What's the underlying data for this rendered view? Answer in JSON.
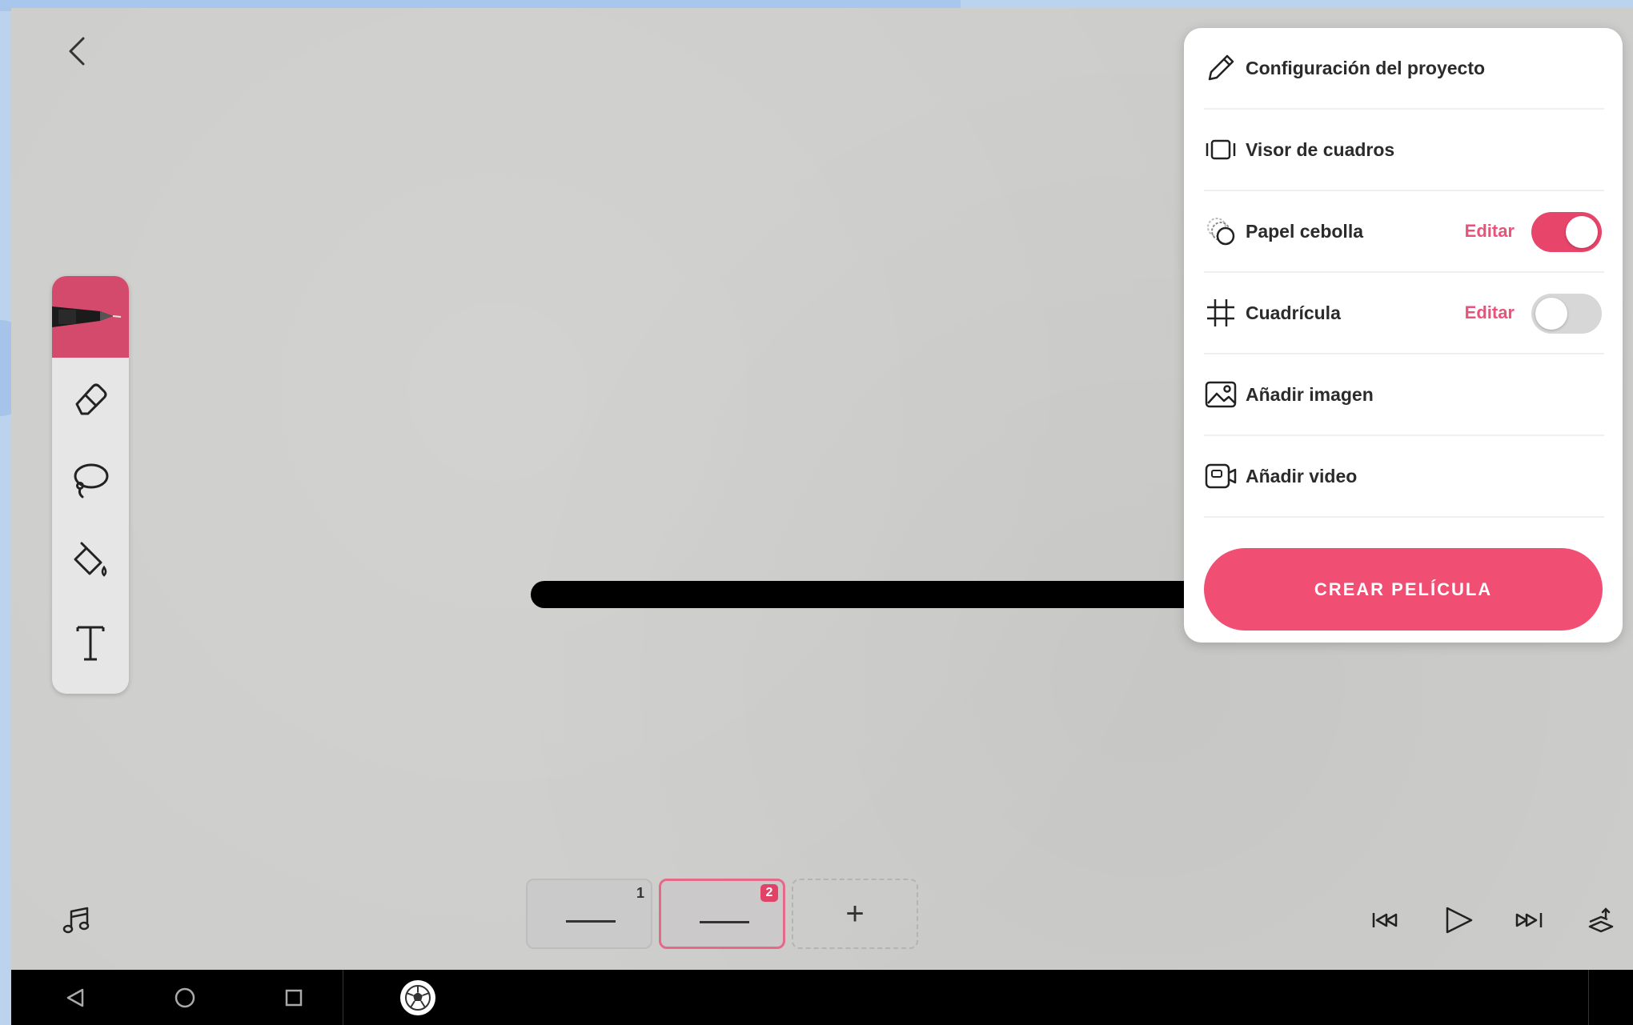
{
  "menu": {
    "items": [
      {
        "label": "Configuración del proyecto",
        "icon": "pencil-icon"
      },
      {
        "label": "Visor de cuadros",
        "icon": "frame-viewer-icon"
      },
      {
        "label": "Papel cebolla",
        "icon": "onion-skin-icon",
        "edit": "Editar",
        "toggle": true
      },
      {
        "label": "Cuadrícula",
        "icon": "grid-icon",
        "edit": "Editar",
        "toggle": false
      },
      {
        "label": "Añadir imagen",
        "icon": "image-icon"
      },
      {
        "label": "Añadir video",
        "icon": "video-icon"
      }
    ],
    "create_button": "CREAR PELÍCULA"
  },
  "toolbar": {
    "tools": [
      "pen-icon",
      "eraser-icon",
      "lasso-icon",
      "fill-bucket-icon",
      "text-tool-icon"
    ],
    "active_tool": "pen"
  },
  "frames": [
    {
      "number": "1"
    },
    {
      "number": "2",
      "selected": true
    }
  ],
  "add_frame_label": "+",
  "colors": {
    "accent": "#f04f73",
    "active_tool": "#d44a6c",
    "canvas": "#cdcdcb",
    "panel": "#ffffff"
  }
}
